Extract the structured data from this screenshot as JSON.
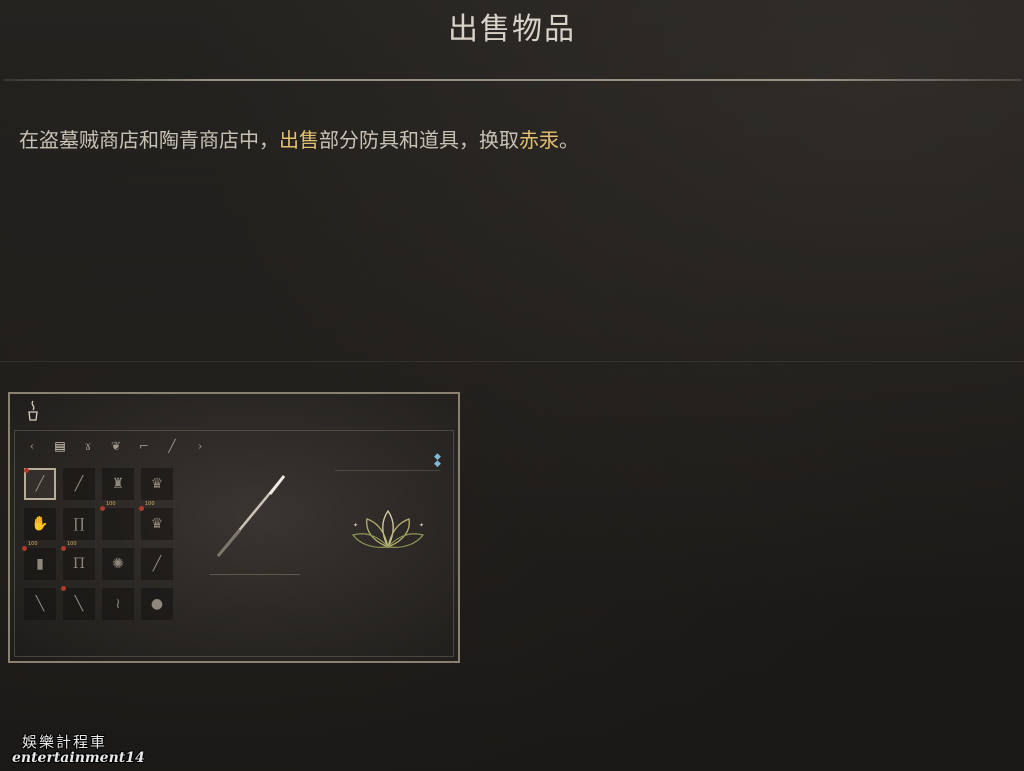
{
  "header": {
    "title": "出售物品"
  },
  "description": {
    "part1": "在盗墓贼商店和陶青商店中，",
    "highlight1": "出售",
    "part2": "部分防具和道具，换取",
    "highlight2": "赤汞",
    "part3": "。",
    "highlight_color": "#e2c072"
  },
  "game_screenshot": {
    "top_icon": "incense-icon",
    "categories": [
      "back-arrow-icon",
      "chest-icon",
      "gourd-icon",
      "leaf-icon",
      "boot-icon",
      "spear-icon",
      "forward-arrow-icon"
    ],
    "item_grid": [
      {
        "icon": "spear-icon",
        "selected": true,
        "marked": true,
        "cost": ""
      },
      {
        "icon": "staff-icon",
        "selected": false,
        "marked": false,
        "cost": ""
      },
      {
        "icon": "helmet-icon",
        "selected": false,
        "marked": false,
        "cost": "100"
      },
      {
        "icon": "armor-icon",
        "selected": false,
        "marked": false,
        "cost": "100"
      },
      {
        "icon": "gauntlet-icon",
        "selected": false,
        "marked": false,
        "cost": "100"
      },
      {
        "icon": "greaves-icon",
        "selected": false,
        "marked": false,
        "cost": "100"
      },
      {
        "icon": "empty-icon",
        "selected": false,
        "marked": true,
        "cost": ""
      },
      {
        "icon": "armor-icon",
        "selected": false,
        "marked": true,
        "cost": ""
      },
      {
        "icon": "bracer-icon",
        "selected": false,
        "marked": true,
        "cost": ""
      },
      {
        "icon": "leggings-icon",
        "selected": false,
        "marked": true,
        "cost": ""
      },
      {
        "icon": "wreath-icon",
        "selected": false,
        "marked": false,
        "cost": ""
      },
      {
        "icon": "staff-icon",
        "selected": false,
        "marked": false,
        "cost": ""
      },
      {
        "icon": "rod-icon",
        "selected": false,
        "marked": false,
        "cost": ""
      },
      {
        "icon": "rod-icon",
        "selected": false,
        "marked": true,
        "cost": ""
      },
      {
        "icon": "vine-icon",
        "selected": false,
        "marked": false,
        "cost": ""
      },
      {
        "icon": "mask-icon",
        "selected": false,
        "marked": false,
        "cost": ""
      }
    ],
    "preview_icon": "spear-icon",
    "attribute_icon": "lotus-icon",
    "gem_icon": "diamond-icon"
  },
  "watermark": {
    "cn": "娛樂計程車",
    "en": "entertainment14"
  }
}
